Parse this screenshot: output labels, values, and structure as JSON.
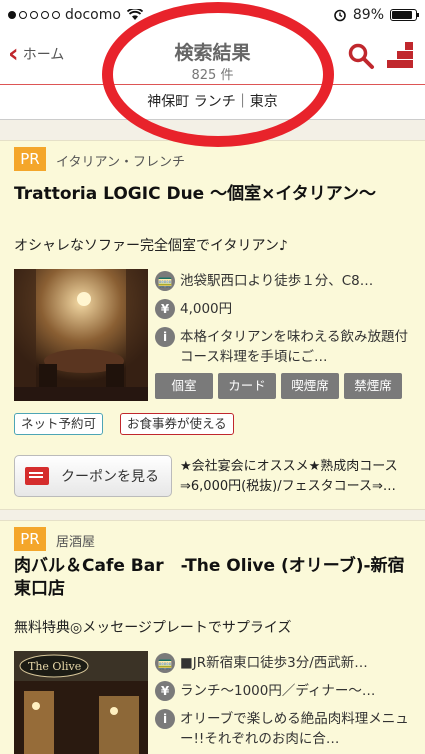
{
  "status": {
    "carrier": "docomo",
    "battery": "89%",
    "signal_dots": [
      true,
      false,
      false,
      false,
      false
    ]
  },
  "nav": {
    "back_label": "ホーム",
    "title": "検索結果",
    "count": "825 件"
  },
  "conditions": {
    "text": "神保町 ランチ｜東京"
  },
  "results": [
    {
      "pr": "PR",
      "genre": "イタリアン・フレンチ",
      "title": "Trattoria  LOGIC Due 〜個室×イタリアン〜",
      "catch": "オシャレなソファー完全個室でイタリアン♪",
      "access": "池袋駅西口より徒歩１分、C8…",
      "budget": "4,000円",
      "description": "本格イタリアンを味わえる飲み放題付コース料理を手頃にご…",
      "tags": [
        "個室",
        "カード",
        "喫煙席",
        "禁煙席"
      ],
      "badges": {
        "net": "ネット予約可",
        "meal": "お食事券が使える"
      },
      "coupon_label": "クーポンを見る",
      "coupon_text": "★会社宴会にオススメ★熟成肉コース⇒6,000円(税抜)/フェスタコース⇒…"
    },
    {
      "pr": "PR",
      "genre": "居酒屋",
      "title": "肉バル＆Cafe Bar　-The Olive (オリーブ)-新宿東口店",
      "catch": "無料特典◎メッセージプレートでサプライズ",
      "access": "■JR新宿東口徒歩3分/西武新…",
      "budget": "ランチ〜1000円／ディナー〜…",
      "description": "オリーブで楽しめる絶品肉料理メニュー!!それぞれのお肉に合…",
      "photo_sign": "The Olive"
    }
  ],
  "colors": {
    "accent": "#c0272d",
    "pr": "#f4a62a",
    "card_bg": "#fbf9d9",
    "annotation": "#e8232b"
  }
}
